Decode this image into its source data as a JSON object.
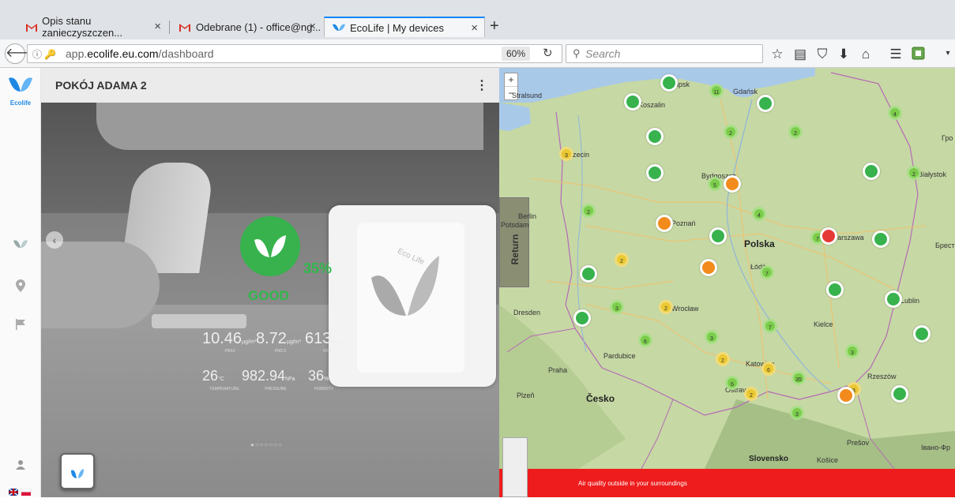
{
  "browser": {
    "tabs": [
      {
        "title": "Opis stanu zanieczyszczen...",
        "icon": "gmail-icon",
        "active": false
      },
      {
        "title": "Odebrane (1) - office@ng...",
        "icon": "gmail-icon",
        "active": false
      },
      {
        "title": "EcoLife | My devices",
        "icon": "ecolife-icon",
        "active": true
      }
    ],
    "close_glyph": "×",
    "new_tab_glyph": "+",
    "url_prefix": "app.",
    "url_domain": "ecolife.eu.com",
    "url_path": "/dashboard",
    "url_info_glyph": "ⓘ",
    "zoom": "60%",
    "search_placeholder": "Search",
    "toolbar_icons": [
      "star-icon",
      "reader-icon",
      "pocket-icon",
      "download-icon",
      "home-icon",
      "menu-icon",
      "extension-icon"
    ]
  },
  "sidebar": {
    "logo_text": "Ecolife",
    "items": [
      "leaf-icon",
      "location-pin-icon",
      "flag-icon",
      "user-icon",
      "language-flag-icon"
    ]
  },
  "device": {
    "name": "POKÓJ ADAMA 2",
    "menu_glyph": "⋮",
    "air_quality_percent": "35%",
    "air_quality_status": "GOOD",
    "metrics_row1": [
      {
        "value": "10.46",
        "unit": "µg/m³",
        "label": "PM10"
      },
      {
        "value": "8.72",
        "unit": "µg/m³",
        "label": "PM2.5"
      },
      {
        "value": "613",
        "unit": "ppm",
        "label": "VOC"
      }
    ],
    "metrics_row2": [
      {
        "value": "26",
        "unit": "°C",
        "label": "TEMPERATURE"
      },
      {
        "value": "982.94",
        "unit": "hPa",
        "label": "PRESSURE"
      },
      {
        "value": "36",
        "unit": "%",
        "label": "HUMIDITY"
      }
    ],
    "device_label": "Eco Life",
    "carousel_left": "‹",
    "carousel_right": "›",
    "carousel_dots": "●○○○○○○"
  },
  "map": {
    "zoom_in": "+",
    "zoom_out": "−",
    "return_label": "Return",
    "footer_text": "Air quality outside in your surroundings",
    "country_label": "Polska",
    "places": [
      {
        "name": "Gdańsk",
        "big": false
      },
      {
        "name": "Szczecin",
        "big": false
      },
      {
        "name": "Bydgoszcz",
        "big": false
      },
      {
        "name": "Białystok",
        "big": false
      },
      {
        "name": "Berlin",
        "big": false
      },
      {
        "name": "Potsdam",
        "big": false
      },
      {
        "name": "Poznań",
        "big": false
      },
      {
        "name": "Warszawa",
        "big": false
      },
      {
        "name": "Łódź",
        "big": false
      },
      {
        "name": "Dresden",
        "big": false
      },
      {
        "name": "Wrocław",
        "big": false
      },
      {
        "name": "Lublin",
        "big": false
      },
      {
        "name": "Kielce",
        "big": false
      },
      {
        "name": "Praha",
        "big": false
      },
      {
        "name": "Pardubice",
        "big": false
      },
      {
        "name": "Katowice",
        "big": false
      },
      {
        "name": "Ostrava",
        "big": false
      },
      {
        "name": "Plzeň",
        "big": false
      },
      {
        "name": "Česko",
        "big": true
      },
      {
        "name": "Rzeszów",
        "big": false
      },
      {
        "name": "Prešov",
        "big": false
      },
      {
        "name": "Košice",
        "big": false
      },
      {
        "name": "Slovensko",
        "big": true
      },
      {
        "name": "Брест",
        "big": false
      },
      {
        "name": "Гро",
        "big": false
      },
      {
        "name": "Івано-Фр",
        "big": false
      },
      {
        "name": "Stralsund",
        "big": false
      },
      {
        "name": "Koszalin",
        "big": false
      },
      {
        "name": "Słupsk",
        "big": false
      }
    ],
    "clusters": [
      {
        "count": "11",
        "color": "green"
      },
      {
        "count": "4",
        "color": "green"
      },
      {
        "count": "2",
        "color": "green"
      },
      {
        "count": "2",
        "color": "green"
      },
      {
        "count": "2",
        "color": "green"
      },
      {
        "count": "3",
        "color": "yellow"
      },
      {
        "count": "5",
        "color": "green"
      },
      {
        "count": "2",
        "color": "green"
      },
      {
        "count": "4",
        "color": "green"
      },
      {
        "count": "2",
        "color": "green"
      },
      {
        "count": "7",
        "color": "green"
      },
      {
        "count": "2",
        "color": "yellow"
      },
      {
        "count": "7",
        "color": "green"
      },
      {
        "count": "3",
        "color": "green"
      },
      {
        "count": "2",
        "color": "yellow"
      },
      {
        "count": "7",
        "color": "green"
      },
      {
        "count": "6",
        "color": "green"
      },
      {
        "count": "3",
        "color": "green"
      },
      {
        "count": "3",
        "color": "green"
      },
      {
        "count": "2",
        "color": "yellow"
      },
      {
        "count": "6",
        "color": "yellow"
      },
      {
        "count": "35",
        "color": "green"
      },
      {
        "count": "6",
        "color": "green"
      },
      {
        "count": "2",
        "color": "yellow"
      },
      {
        "count": "3",
        "color": "yellow"
      },
      {
        "count": "3",
        "color": "green"
      }
    ],
    "pins": [
      "green",
      "green",
      "green",
      "green",
      "green",
      "green",
      "orange",
      "green",
      "orange",
      "red",
      "green",
      "orange",
      "green",
      "green",
      "green",
      "green",
      "green",
      "orange",
      "green",
      "green"
    ]
  },
  "colors": {
    "accent": "#37b24d",
    "brand_blue": "#1e88e5",
    "footer_red": "#ee1c1c",
    "tab_active_line": "#0a84ff"
  }
}
